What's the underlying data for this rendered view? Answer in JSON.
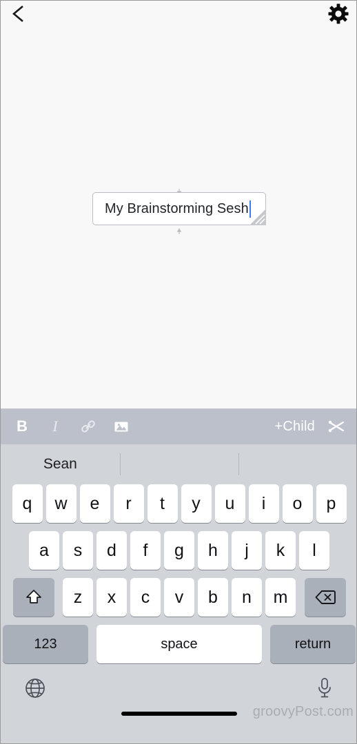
{
  "app": {
    "topbar": {
      "back_label": "Back",
      "settings_label": "Settings"
    },
    "canvas": {
      "node": {
        "text": "My Brainstorming Sesh",
        "has_caret": true,
        "resize_handle_label": "Resize"
      },
      "background_color": "#f8f8f9"
    }
  },
  "toolbar": {
    "background_color": "#bcc0cb",
    "bold_label": "B",
    "italic_label": "I",
    "link_label": "Link",
    "image_label": "Image",
    "add_child_label": "+Child",
    "cut_label": "Cut"
  },
  "keyboard": {
    "background_color": "#d1d4d9",
    "key_color": "#ffffff",
    "modifier_key_color": "#aab0b9",
    "suggestions": [
      "Sean",
      "",
      ""
    ],
    "row1": [
      "q",
      "w",
      "e",
      "r",
      "t",
      "y",
      "u",
      "i",
      "o",
      "p"
    ],
    "row2": [
      "a",
      "s",
      "d",
      "f",
      "g",
      "h",
      "j",
      "k",
      "l"
    ],
    "row3": [
      "z",
      "x",
      "c",
      "v",
      "b",
      "n",
      "m"
    ],
    "shift_label": "Shift",
    "backspace_label": "Backspace",
    "numbers_label": "123",
    "space_label": "space",
    "return_label": "return",
    "globe_label": "Next keyboard",
    "dictation_label": "Dictation"
  },
  "watermark": {
    "text": "groovyPost.com",
    "color": "#a9adb3"
  }
}
